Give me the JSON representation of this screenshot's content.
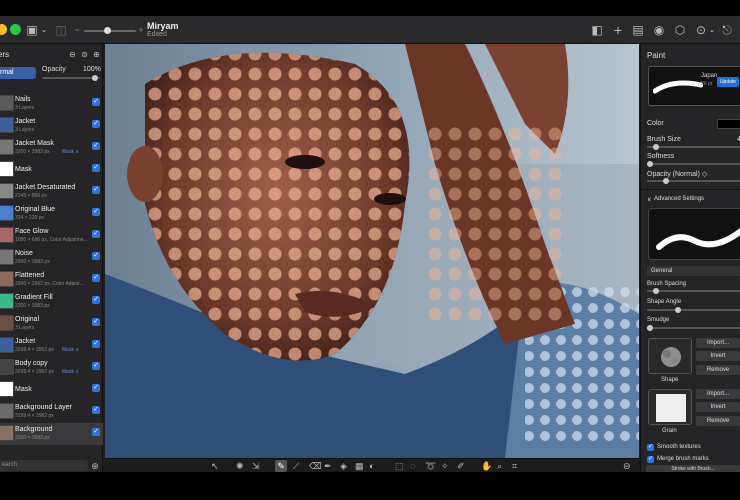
{
  "document": {
    "title": "Miryam",
    "subtitle": "Edited"
  },
  "layers_panel": {
    "title": "ers",
    "blend_mode": "rmal",
    "opacity_label": "Opacity",
    "opacity_value": "100%",
    "search_placeholder": "earch",
    "layers": [
      {
        "name": "Nails",
        "size": "3 Layers",
        "mask": "",
        "thumb": "#5a5a5a"
      },
      {
        "name": "Jacket",
        "size": "3 Layers",
        "mask": "",
        "thumb": "#3d5f9a"
      },
      {
        "name": "Jacket Mask",
        "size": "3200 × 2983 px",
        "mask": "Mask ∨",
        "thumb": "#777"
      },
      {
        "name": "Mask",
        "size": "",
        "mask": "",
        "thumb": "#fff"
      },
      {
        "name": "Jacket Desaturated",
        "size": "2145 × 856 px",
        "mask": "",
        "thumb": "#888"
      },
      {
        "name": "Original Blue",
        "size": "314 × 220 px",
        "mask": "",
        "thumb": "#4a7fd0"
      },
      {
        "name": "Face Glow",
        "size": "1080 × 696 px, Color Adjustme...",
        "mask": "",
        "thumb": "#a66"
      },
      {
        "name": "Noise",
        "size": "3300 × 3983 px",
        "mask": "",
        "thumb": "#777"
      },
      {
        "name": "Flattened",
        "size": "3300 × 2962 px, Color Adjust...",
        "mask": "",
        "thumb": "#8a6a5a"
      },
      {
        "name": "Gradient Fill",
        "size": "3300 × 3983 px",
        "mask": "",
        "thumb": "#3cb98a"
      },
      {
        "name": "Original",
        "size": "3 Layers",
        "mask": "",
        "thumb": "#6a5040"
      },
      {
        "name": "Jacket",
        "size": "3298.4 × 2962 px",
        "mask": "Mask ∨",
        "thumb": "#3d5f9a"
      },
      {
        "name": "Body copy",
        "size": "3298.4 × 2962 px",
        "mask": "Mask ∨",
        "thumb": "#444"
      },
      {
        "name": "Mask",
        "size": "",
        "mask": "",
        "thumb": "#fff"
      },
      {
        "name": "Background Layer",
        "size": "3199.4 × 2962 px",
        "mask": "",
        "thumb": "#6a6a6a"
      },
      {
        "name": "Background",
        "size": "3300 × 3983 px",
        "mask": "",
        "thumb": "#8a7060"
      }
    ]
  },
  "paint_panel": {
    "title": "Paint",
    "brush_name": "Japan",
    "brush_size_small": "26 pt",
    "update_label": "Update",
    "color_label": "Color",
    "brush_size_label": "Brush Size",
    "brush_size_value": "4",
    "softness_label": "Softness",
    "opacity_label": "Opacity (Normal) ◇",
    "advanced_label": "Advanced Settings",
    "general_label": "General",
    "brush_spacing_label": "Brush Spacing",
    "shape_angle_label": "Shape Angle",
    "smudge_label": "Smudge",
    "shape_label": "Shape",
    "grain_label": "Grain",
    "import_label": "Import...",
    "invert_label": "Invert",
    "remove_label": "Remove",
    "smooth_textures": "Smooth textures",
    "merge_brush_marks": "Merge brush marks",
    "stroke_label": "Stroke with Brush..."
  },
  "colors": {
    "accent": "#2f73e0",
    "panel": "#252527",
    "update": "#1f6fd6"
  }
}
